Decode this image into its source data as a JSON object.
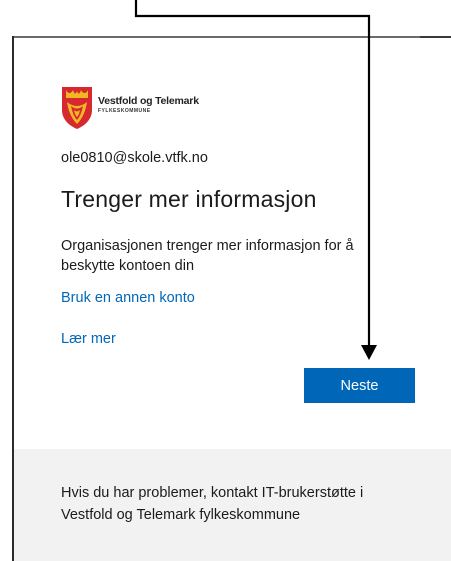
{
  "logo": {
    "name": "Vestfold og Telemark",
    "subtitle": "FYLKESKOMMUNE",
    "icon": "county-coat-of-arms-icon",
    "colors": {
      "shield_red": "#d6282e",
      "shield_yellow": "#f2b824"
    }
  },
  "account": {
    "email": "ole0810@skole.vtfk.no"
  },
  "main": {
    "title": "Trenger mer informasjon",
    "description": "Organisasjonen trenger mer informasjon for å beskytte kontoen din",
    "other_account_link": "Bruk en annen konto",
    "learn_more_link": "Lær mer",
    "next_button": "Neste"
  },
  "footer": {
    "help_text": "Hvis du har problemer, kontakt IT-brukerstøtte i Vestfold og Telemark fylkeskommune"
  },
  "annotation": {
    "icon": "annotation-arrow-icon",
    "color": "#000000"
  },
  "theme": {
    "accent": "#0067b8",
    "text": "#1b1b1b",
    "footer_bg": "#f2f2f2"
  }
}
